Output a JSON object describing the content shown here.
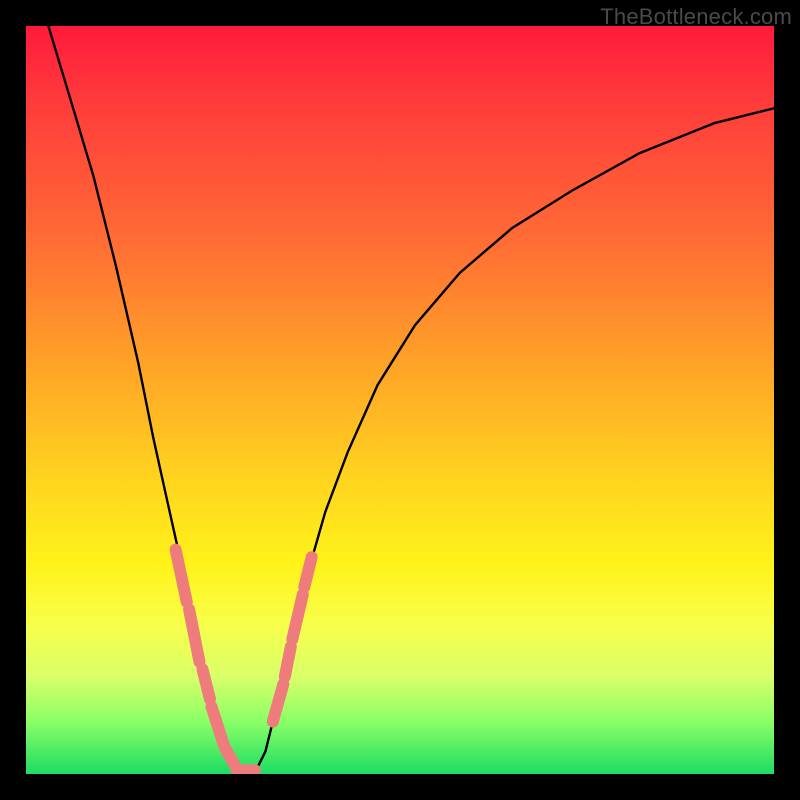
{
  "watermark": "TheBottleneck.com",
  "chart_data": {
    "type": "line",
    "title": "",
    "xlabel": "",
    "ylabel": "",
    "xlim": [
      0,
      100
    ],
    "ylim": [
      0,
      100
    ],
    "series": [
      {
        "name": "bottleneck-curve",
        "x": [
          3,
          6,
          9,
          12,
          15,
          17,
          19,
          21,
          22.5,
          24,
          25.5,
          27,
          28,
          29,
          30,
          31,
          32,
          33,
          34,
          36,
          38,
          40,
          43,
          47,
          52,
          58,
          65,
          73,
          82,
          92,
          100
        ],
        "y": [
          100,
          90,
          80,
          68,
          55,
          45,
          36,
          27,
          20,
          13,
          7,
          3,
          1,
          0,
          0,
          1,
          3,
          7,
          12,
          20,
          28,
          35,
          43,
          52,
          60,
          67,
          73,
          78,
          83,
          87,
          89
        ]
      }
    ],
    "markers": {
      "name": "highlight-segments",
      "color": "#ef7c7d",
      "segments": [
        {
          "x": [
            20.0,
            21.5
          ],
          "y": [
            30,
            23
          ]
        },
        {
          "x": [
            21.8,
            23.2
          ],
          "y": [
            22,
            15
          ]
        },
        {
          "x": [
            23.6,
            24.6
          ],
          "y": [
            14,
            10
          ]
        },
        {
          "x": [
            24.8,
            26.4
          ],
          "y": [
            9,
            4
          ]
        },
        {
          "x": [
            26.6,
            28.0
          ],
          "y": [
            3.5,
            1
          ]
        },
        {
          "x": [
            28.2,
            30.6
          ],
          "y": [
            0.5,
            0.5
          ]
        },
        {
          "x": [
            33.0,
            34.4
          ],
          "y": [
            7,
            12
          ]
        },
        {
          "x": [
            34.6,
            35.4
          ],
          "y": [
            13,
            17
          ]
        },
        {
          "x": [
            35.6,
            37.0
          ],
          "y": [
            18,
            24
          ]
        },
        {
          "x": [
            37.2,
            38.2
          ],
          "y": [
            25,
            29
          ]
        }
      ]
    },
    "background_gradient": {
      "top": "#ff1a3c",
      "bottom": "#1edc64"
    }
  }
}
